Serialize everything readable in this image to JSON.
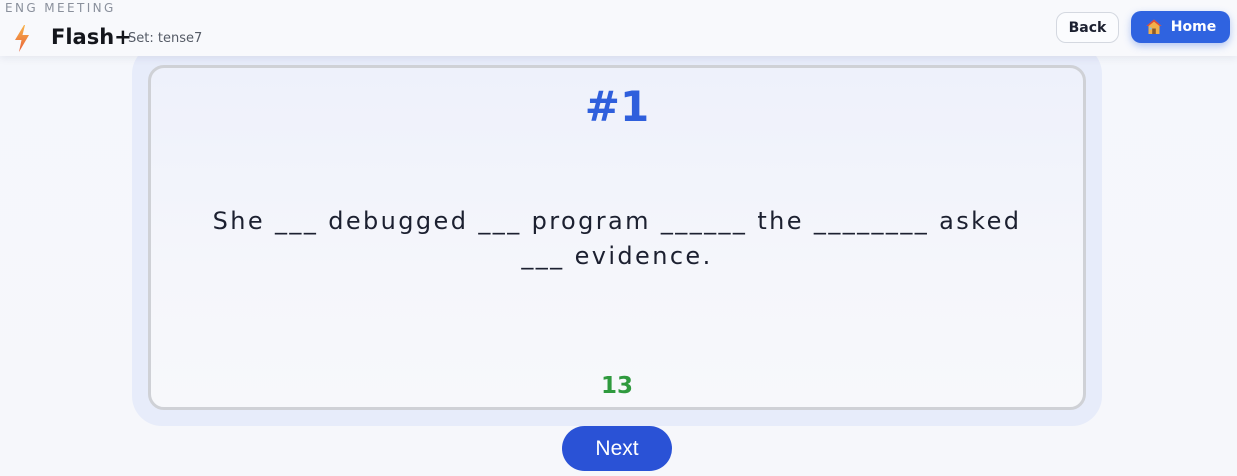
{
  "header": {
    "eyebrow": "ENG MEETING",
    "brand_icon": "lightning-bolt-icon",
    "brand_name": "Flash+",
    "set_label": "Set: tense7",
    "back_label": "Back",
    "home_icon": "house-icon",
    "home_label": "Home"
  },
  "card": {
    "number": "#1",
    "sentence": "She ___ debugged ___ program ______ the ________ asked ___ evidence.",
    "counter": "13"
  },
  "footer": {
    "next_label": "Next"
  },
  "colors": {
    "accent": "#2f63e0",
    "number": "#2f5fdc",
    "counter": "#2f9a3e",
    "next_button": "#2a52d6"
  }
}
